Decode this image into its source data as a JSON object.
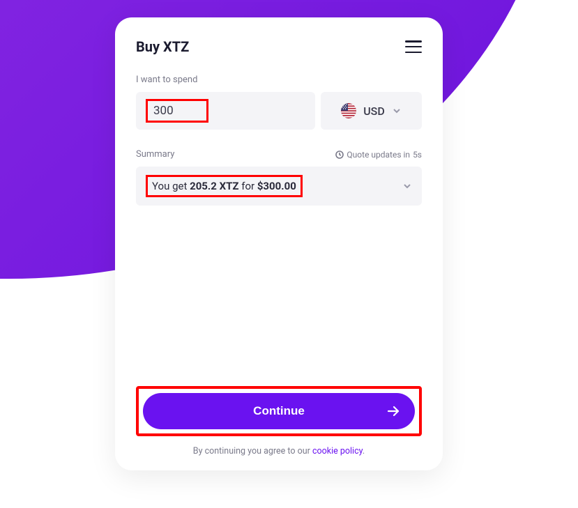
{
  "header": {
    "title": "Buy XTZ"
  },
  "spend": {
    "label": "I want to spend",
    "amount": "300",
    "currency_code": "USD"
  },
  "summary": {
    "label": "Summary",
    "quote_prefix": "Quote updates in ",
    "quote_time": "5s",
    "text_prefix": "You get ",
    "amount_crypto": "205.2 XTZ",
    "text_for": " for ",
    "amount_fiat": "$300.00"
  },
  "continue": {
    "label": "Continue"
  },
  "disclaimer": {
    "prefix": "By continuing you agree to our ",
    "link_text": "cookie policy",
    "suffix": "."
  }
}
